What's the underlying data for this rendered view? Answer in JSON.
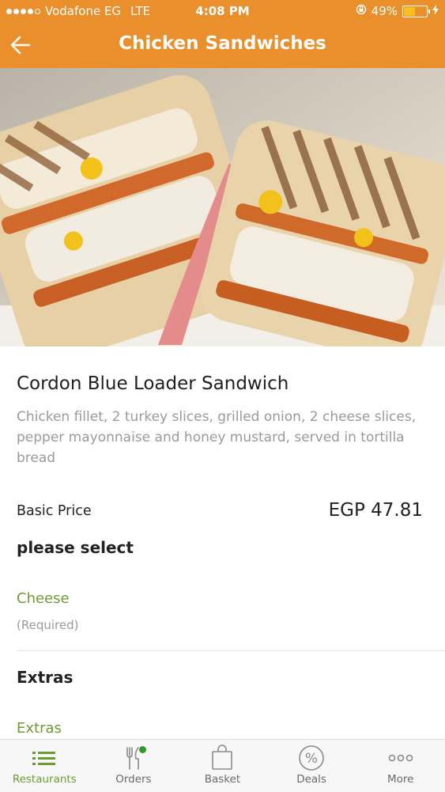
{
  "status_bar": {
    "carrier": "Vodafone EG",
    "network": "LTE",
    "time": "4:08 PM",
    "battery": "49%",
    "battery_level": 0.49
  },
  "header": {
    "title": "Chicken Sandwiches",
    "back_icon": "arrow-left-icon"
  },
  "hero": {
    "image": "sandwich-photo"
  },
  "item": {
    "name": "Cordon Blue Loader Sandwich",
    "description": "Chicken fillet, 2 turkey slices, grilled onion, 2 cheese slices, pepper mayonnaise and honey mustard, served in tortilla bread",
    "price_label": "Basic Price",
    "price": "EGP 47.81"
  },
  "options": {
    "select_title": "please select",
    "cheese_label": "Cheese",
    "required_label": "(Required)",
    "extras_title": "Extras",
    "extras_label": "Extras"
  },
  "tabs": [
    {
      "label": "Restaurants",
      "icon": "list-icon",
      "active": true
    },
    {
      "label": "Orders",
      "icon": "fork-knife-icon",
      "active": false
    },
    {
      "label": "Basket",
      "icon": "bag-icon",
      "active": false
    },
    {
      "label": "Deals",
      "icon": "percent-icon",
      "active": false
    },
    {
      "label": "More",
      "icon": "more-dots-icon",
      "active": false
    }
  ],
  "colors": {
    "header": "#e98f2c",
    "accent_green": "#6c9d33",
    "battery_fill": "#f6c021"
  }
}
